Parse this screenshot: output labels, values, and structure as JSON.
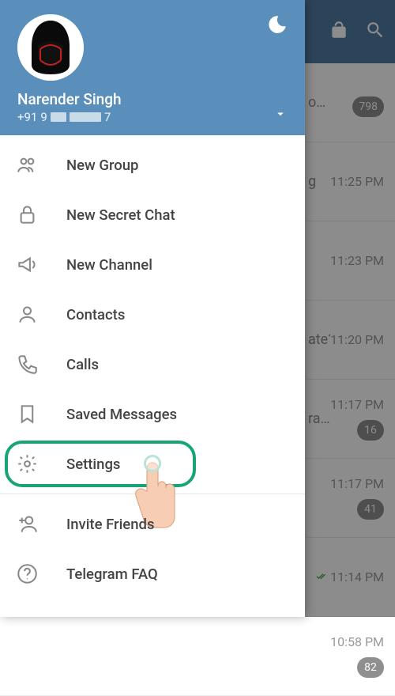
{
  "header": {
    "user_name": "Narender Singh",
    "phone_prefix": "+91",
    "phone_visible_digit_left": "9",
    "phone_visible_digit_right": "7"
  },
  "drawer": {
    "items": [
      {
        "label": "New Group",
        "icon": "group-icon"
      },
      {
        "label": "New Secret Chat",
        "icon": "lock-icon"
      },
      {
        "label": "New Channel",
        "icon": "megaphone-icon"
      },
      {
        "label": "Contacts",
        "icon": "person-icon"
      },
      {
        "label": "Calls",
        "icon": "phone-icon"
      },
      {
        "label": "Saved Messages",
        "icon": "bookmark-icon"
      },
      {
        "label": "Settings",
        "icon": "gear-icon"
      },
      {
        "label": "Invite Friends",
        "icon": "add-person-icon"
      },
      {
        "label": "Telegram FAQ",
        "icon": "help-icon"
      }
    ]
  },
  "chats": [
    {
      "preview": "o…",
      "time": "",
      "badge": "798"
    },
    {
      "preview": "g",
      "time": "11:25 PM",
      "badge": ""
    },
    {
      "preview": "",
      "time": "11:23 PM",
      "badge": ""
    },
    {
      "preview": "ate? N…",
      "time": "11:20 PM",
      "badge": ""
    },
    {
      "preview": "ra…",
      "time": "11:17 PM",
      "badge": "16"
    },
    {
      "preview": "",
      "time": "11:17 PM",
      "badge": "41"
    },
    {
      "preview": "",
      "time": "11:14 PM",
      "badge": "",
      "checks": true
    },
    {
      "preview": "",
      "time": "10:58 PM",
      "badge": "82"
    }
  ]
}
